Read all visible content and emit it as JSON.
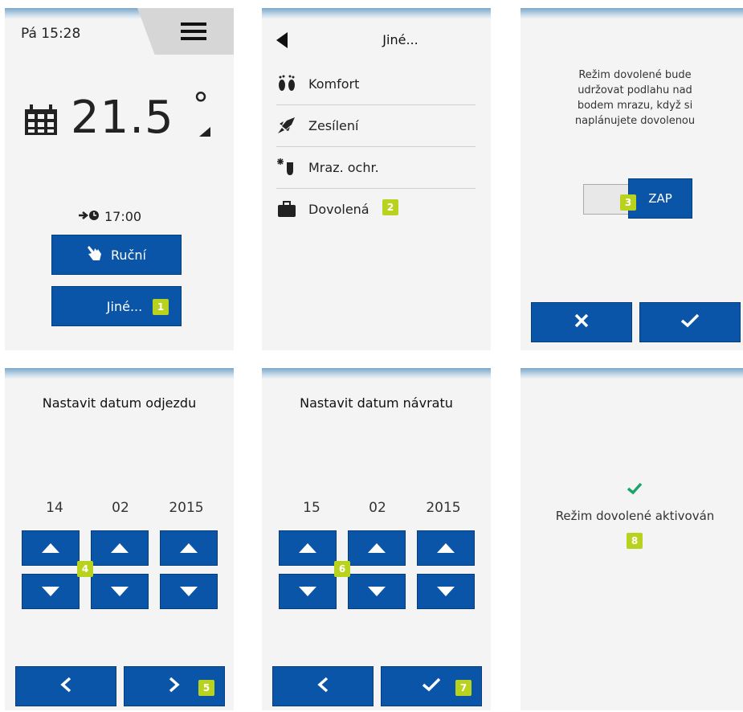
{
  "screen1": {
    "day_time": "Pá 15:28",
    "temperature": "21.5",
    "degree": "°",
    "next_time": "17:00",
    "manual_label": "Ruční",
    "other_label": "Jiné...",
    "badge": "1",
    "icons": [
      "menu-icon",
      "calendar-icon",
      "arrow-clock-icon",
      "hand-icon"
    ]
  },
  "screen2": {
    "title": "Jiné...",
    "items": [
      {
        "label": "Komfort",
        "icon": "feet-icon"
      },
      {
        "label": "Zesílení",
        "icon": "rocket-icon"
      },
      {
        "label": "Mraz. ochr.",
        "icon": "frost-icon"
      },
      {
        "label": "Dovolená",
        "icon": "suitcase-icon"
      }
    ],
    "badge": "2"
  },
  "screen3": {
    "text_lines": [
      "Režim dovolené bude",
      "udržovat podlahu nad",
      "bodem mrazu, když si",
      "naplánujete dovolenou"
    ],
    "toggle_label": "ZAP",
    "badge": "3"
  },
  "screen4": {
    "title": "Nastavit datum odjezdu",
    "day": "14",
    "month": "02",
    "year": "2015",
    "badge_arrows": "4",
    "badge_next": "5"
  },
  "screen5": {
    "title": "Nastavit datum návratu",
    "day": "15",
    "month": "02",
    "year": "2015",
    "badge_arrows": "6",
    "badge_confirm": "7"
  },
  "screen6": {
    "message": "Režim dovolené aktivován",
    "badge": "8"
  },
  "colors": {
    "button": "#0a55a8",
    "badge": "#b9d21e",
    "check": "#1aa36a"
  }
}
